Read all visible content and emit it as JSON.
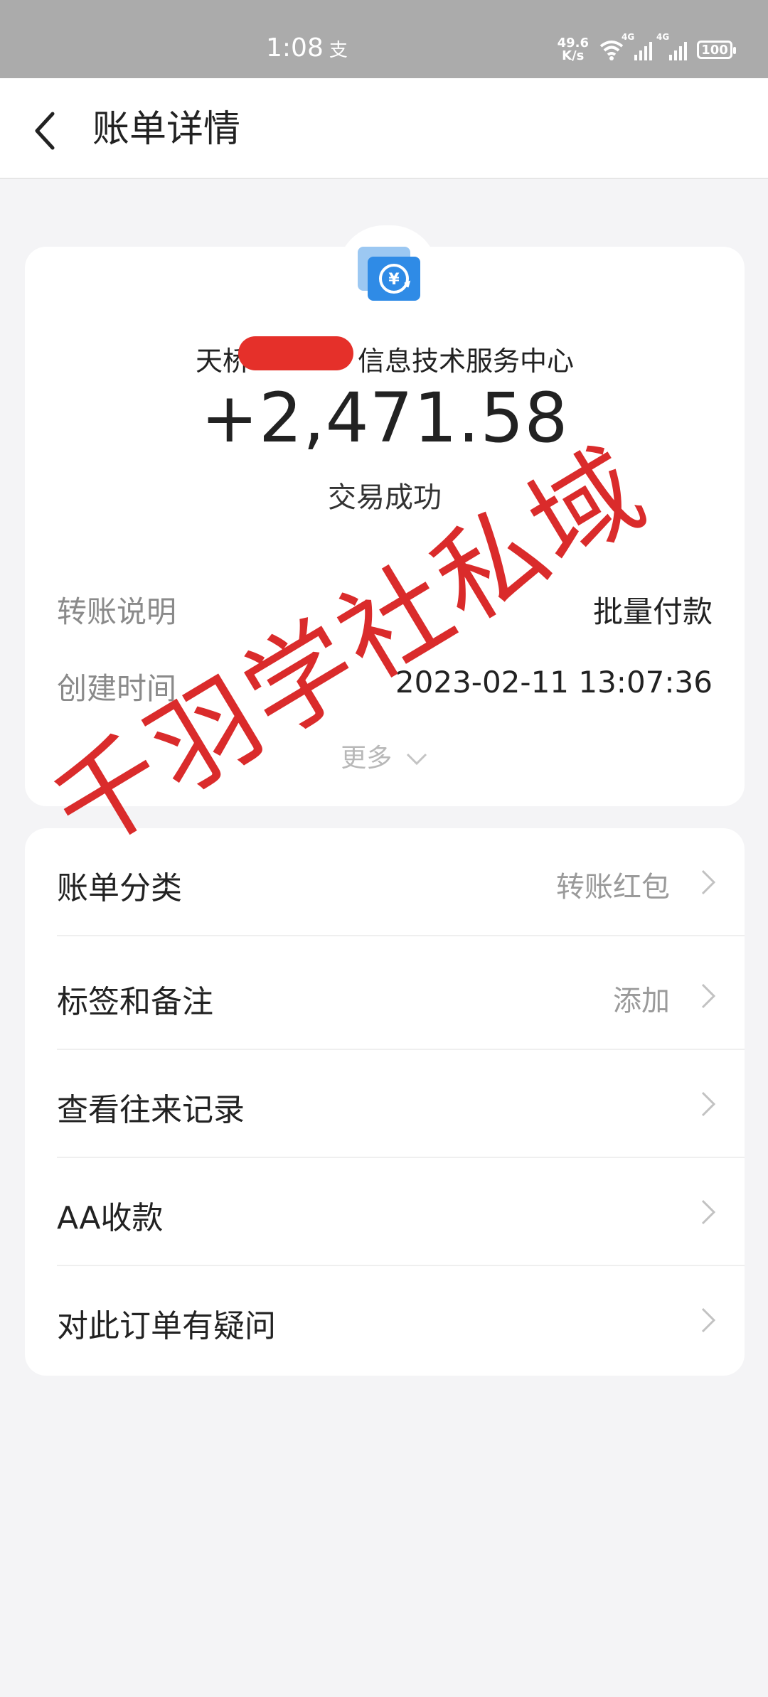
{
  "status_bar": {
    "time": "1:08",
    "app_indicator": "支",
    "net_speed_value": "49.6",
    "net_speed_unit": "K/s",
    "signal_tag_1": "4G",
    "signal_tag_2": "4G",
    "battery": "100"
  },
  "header": {
    "title": "账单详情",
    "back_icon": "back-chevron-icon"
  },
  "transaction": {
    "merchant_name": "天桥　　　　信息技术服务中心",
    "amount": "+2,471.58",
    "status": "交易成功",
    "details": [
      {
        "key": "转账说明",
        "value": "批量付款"
      },
      {
        "key": "创建时间",
        "value": "2023-02-11 13:07:36"
      }
    ],
    "more": "更多"
  },
  "actions": [
    {
      "label": "账单分类",
      "value": "转账红包"
    },
    {
      "label": "标签和备注",
      "value": "添加"
    },
    {
      "label": "查看往来记录",
      "value": ""
    },
    {
      "label": "AA收款",
      "value": ""
    },
    {
      "label": "对此订单有疑问",
      "value": ""
    }
  ],
  "watermark": "千羽学社私域",
  "colors": {
    "accent_blue": "#2f8be6",
    "redaction": "#e5302a",
    "watermark": "#d71919"
  }
}
